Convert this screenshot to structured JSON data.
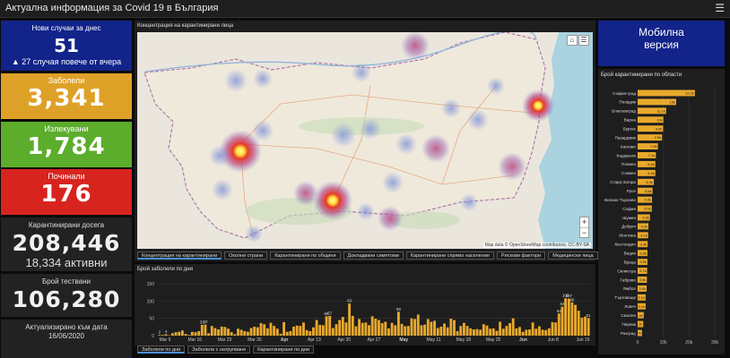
{
  "header": {
    "title": "Актуална информация за Covid 19 в България",
    "menu_icon": "hamburger-icon"
  },
  "tiles": {
    "new_cases": {
      "label": "Нови случаи за днес",
      "value": "51",
      "sub": "▲ 27 случая повече от вчера"
    },
    "sick": {
      "label": "Заболели",
      "value": "3,341"
    },
    "recovered": {
      "label": "Излекувани",
      "value": "1,784"
    },
    "dead": {
      "label": "Починали",
      "value": "176"
    },
    "quarantined": {
      "label": "Карантинирани досега",
      "value": "208,446",
      "sub": "18,334 активни"
    },
    "tests": {
      "label": "Брой тествани",
      "value": "106,280"
    },
    "updated": {
      "label": "Актуализирано към дата",
      "date": "16/06/2020"
    }
  },
  "colors": {
    "new": "#12238a",
    "sick": "#dea128",
    "recovered": "#5cad2c",
    "dead": "#d8241f",
    "bar": "#e9a92c"
  },
  "map": {
    "title": "Концентрация на карантинирани лица",
    "attribution": "Map data © OpenStreetMap contributors, CC-BY-SA",
    "zoom_in": "+",
    "zoom_out": "−"
  },
  "map_tabs": [
    "Концентрация на карантинирани",
    "Околни страни",
    "Карантинирани по общини",
    "Докладвани симптоми",
    "Карантинирани спрямо население",
    "Рискови фактори",
    "Медицински лица"
  ],
  "mobile": {
    "line1": "Мобилна",
    "line2": "версия"
  },
  "chart_data": [
    {
      "type": "bar",
      "title": "Брой заболели по дни",
      "ylim": [
        0,
        150
      ],
      "yticks": [
        0,
        50,
        100,
        150
      ],
      "xticks": [
        "Mar 9",
        "Mar 16",
        "Mar 23",
        "Mar 30",
        "Apr",
        "Apr 13",
        "Apr 20",
        "Apr 27",
        "May",
        "May 11",
        "May 18",
        "May 25",
        "Jun",
        "Jun 8",
        "Jun 15"
      ],
      "values": [
        2,
        2,
        4,
        1,
        7,
        10,
        11,
        15,
        5,
        2,
        11,
        10,
        13,
        31,
        32,
        7,
        28,
        22,
        18,
        26,
        25,
        20,
        10,
        4,
        20,
        17,
        13,
        11,
        22,
        26,
        24,
        36,
        33,
        21,
        37,
        28,
        20,
        5,
        39,
        11,
        13,
        26,
        29,
        28,
        38,
        16,
        13,
        24,
        45,
        31,
        30,
        56,
        57,
        22,
        33,
        45,
        54,
        38,
        93,
        57,
        27,
        48,
        37,
        38,
        30,
        56,
        49,
        45,
        36,
        40,
        21,
        37,
        30,
        69,
        34,
        27,
        28,
        50,
        48,
        61,
        30,
        32,
        48,
        40,
        43,
        22,
        26,
        35,
        24,
        49,
        45,
        13,
        28,
        37,
        28,
        21,
        18,
        19,
        17,
        33,
        29,
        20,
        21,
        14,
        40,
        20,
        28,
        36,
        50,
        21,
        25,
        11,
        17,
        18,
        38,
        20,
        27,
        17,
        16,
        21,
        39,
        38,
        64,
        84,
        108,
        107,
        96,
        89,
        72,
        52,
        55,
        51
      ],
      "labels_shown": [
        {
          "i": 0,
          "v": 2
        },
        {
          "i": 2,
          "v": 4
        },
        {
          "i": 13,
          "v": 31
        },
        {
          "i": 14,
          "v": 32
        },
        {
          "i": 51,
          "v": 56
        },
        {
          "i": 52,
          "v": 57
        },
        {
          "i": 58,
          "v": 93
        },
        {
          "i": 73,
          "v": 69
        },
        {
          "i": 122,
          "v": 64
        },
        {
          "i": 123,
          "v": 84
        },
        {
          "i": 124,
          "v": 108
        },
        {
          "i": 125,
          "v": 107
        },
        {
          "i": 126,
          "v": 96
        },
        {
          "i": 131,
          "v": 51
        }
      ]
    },
    {
      "type": "bar",
      "title": "Брой карантинирани по области",
      "orientation": "horizontal",
      "xlim": [
        0,
        30000
      ],
      "xticks": [
        "0",
        "10k",
        "20k",
        "30k"
      ],
      "categories": [
        "София-град",
        "Пловдив",
        "Благоевград",
        "Варна",
        "Бургас",
        "Пазарджик",
        "Хасково",
        "Кърджали",
        "Плевен",
        "Сливен",
        "Стара Загора",
        "Русе",
        "Велико Търново",
        "София",
        "Шумен",
        "Добрич",
        "Монтана",
        "Кюстендил",
        "Видин",
        "Враца",
        "Силистра",
        "Габрово",
        "Ямбол",
        "Търговище",
        "Ловеч",
        "Смолян",
        "Перник",
        "Разград"
      ],
      "values": [
        22300,
        15000,
        11100,
        10000,
        9900,
        9500,
        7900,
        7100,
        6900,
        6900,
        6300,
        5800,
        5600,
        5500,
        4800,
        4200,
        4100,
        3900,
        3800,
        3800,
        3700,
        3600,
        3500,
        3100,
        3100,
        2400,
        2200,
        1700
      ],
      "value_labels": [
        "22.3k",
        "15k",
        "11.1k",
        "10k",
        "9.9k",
        "9.5k",
        "7.9k",
        "7.1k",
        "6.9k",
        "6.9k",
        "6.3k",
        "5.8k",
        "5.6k",
        "5.5k",
        "4.8k",
        "4.2k",
        "4.1k",
        "3.9k",
        "3.8k",
        "3.8k",
        "3.7k",
        "3.6k",
        "3.5k",
        "3.1k",
        "3.1k",
        "2.4k",
        "2.2k",
        "1.7k"
      ]
    }
  ],
  "chart_tabs": [
    "Заболели по дни",
    "Заболели с натрупване",
    "Карантинирани по дни"
  ]
}
